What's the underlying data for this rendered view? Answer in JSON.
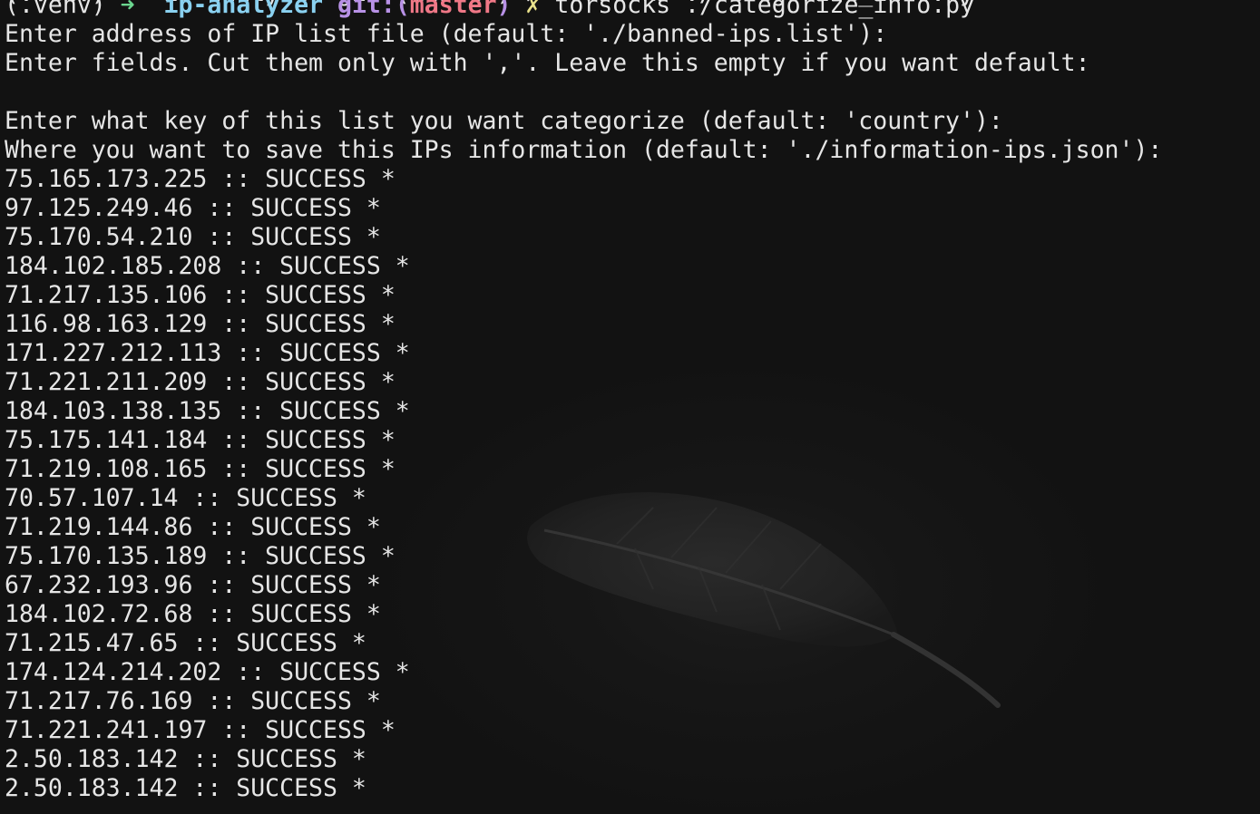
{
  "colors": {
    "background": "#121212",
    "text": "#e6e6e6",
    "prompt_arrow": "#6bd68f",
    "prompt_directory": "#8ad1f0",
    "prompt_git": "#b891e6",
    "prompt_branch": "#f07887",
    "dirty_mark": "#e9e28c"
  },
  "previous_line": "(.venv) ➜  ip-analyzer git:(master) ✗ torsocks ./categorize_info.py",
  "prompt": {
    "venv": "(.venv)",
    "arrow": "➜",
    "directory": "ip-analyzer",
    "git_prefix": "git:(",
    "branch": "master",
    "git_suffix": ")",
    "dirty_mark": "✗",
    "command": "torsocks ./categorize_info.py"
  },
  "prompts": [
    "Enter address of IP list file (default: './banned-ips.list'):",
    "Enter fields. Cut them only with ','. Leave this empty if you want default:",
    "",
    "Enter what key of this list you want categorize (default: 'country'):",
    "Where you want to save this IPs information (default: './information-ips.json'):"
  ],
  "results": [
    "75.165.173.225 :: SUCCESS *",
    "97.125.249.46 :: SUCCESS *",
    "75.170.54.210 :: SUCCESS *",
    "184.102.185.208 :: SUCCESS *",
    "71.217.135.106 :: SUCCESS *",
    "116.98.163.129 :: SUCCESS *",
    "171.227.212.113 :: SUCCESS *",
    "71.221.211.209 :: SUCCESS *",
    "184.103.138.135 :: SUCCESS *",
    "75.175.141.184 :: SUCCESS *",
    "71.219.108.165 :: SUCCESS *",
    "70.57.107.14 :: SUCCESS *",
    "71.219.144.86 :: SUCCESS *",
    "75.170.135.189 :: SUCCESS *",
    "67.232.193.96 :: SUCCESS *",
    "184.102.72.68 :: SUCCESS *",
    "71.215.47.65 :: SUCCESS *",
    "174.124.214.202 :: SUCCESS *",
    "71.217.76.169 :: SUCCESS *",
    "71.221.241.197 :: SUCCESS *",
    "2.50.183.142 :: SUCCESS *",
    "2.50.183.142 :: SUCCESS *"
  ]
}
